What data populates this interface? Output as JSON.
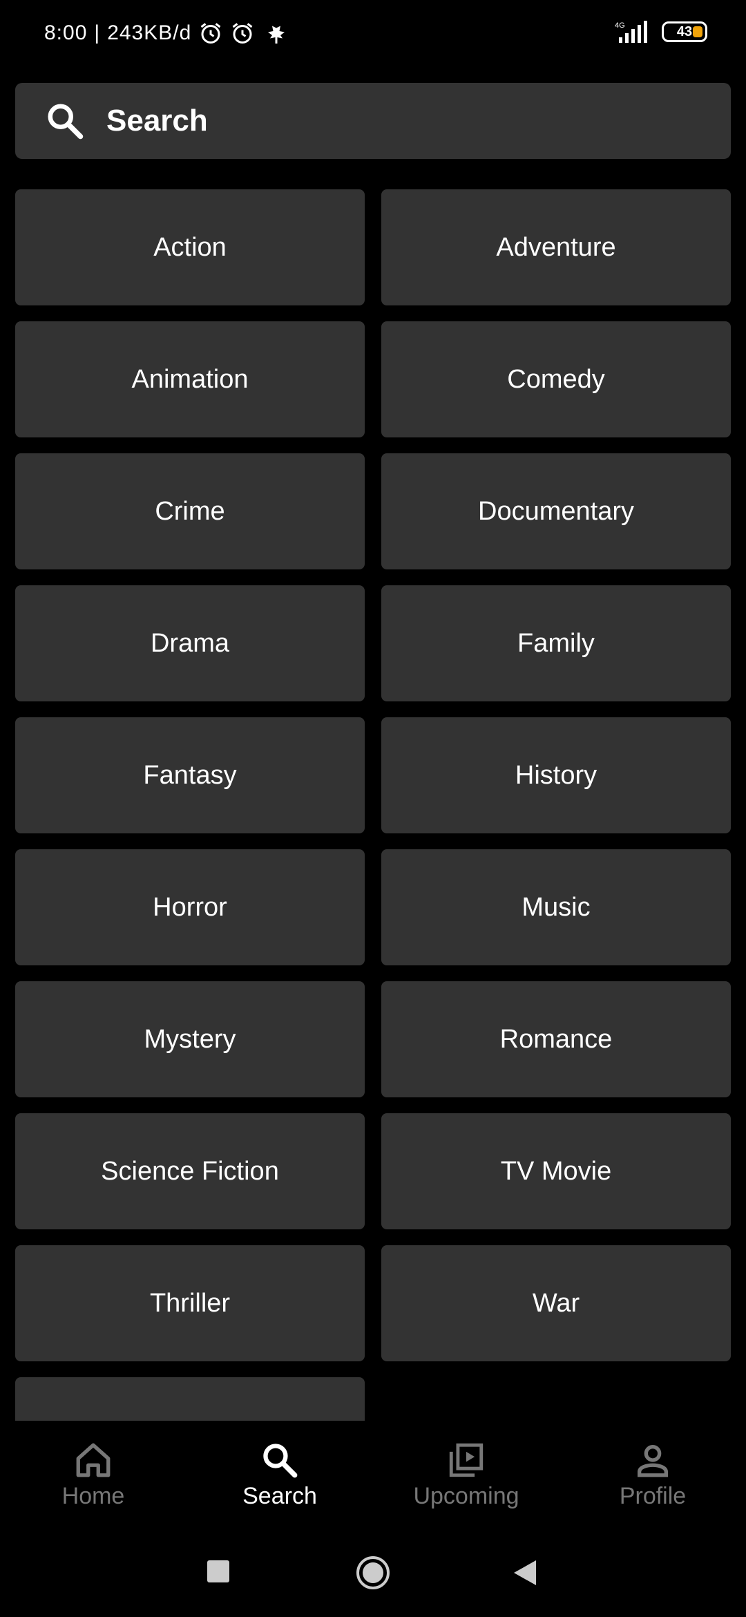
{
  "status_bar": {
    "time": "8:00",
    "net_speed": "243KB/d",
    "network": "4G",
    "battery": "43"
  },
  "search": {
    "placeholder": "Search"
  },
  "genres": [
    "Action",
    "Adventure",
    "Animation",
    "Comedy",
    "Crime",
    "Documentary",
    "Drama",
    "Family",
    "Fantasy",
    "History",
    "Horror",
    "Music",
    "Mystery",
    "Romance",
    "Science Fiction",
    "TV Movie",
    "Thriller",
    "War",
    ""
  ],
  "bottom_nav": {
    "items": [
      {
        "label": "Home",
        "icon": "home-icon"
      },
      {
        "label": "Search",
        "icon": "search-icon",
        "active": true
      },
      {
        "label": "Upcoming",
        "icon": "video-library-icon"
      },
      {
        "label": "Profile",
        "icon": "person-icon"
      }
    ]
  },
  "colors": {
    "background": "#000000",
    "tile": "#333333",
    "active": "#ffffff",
    "inactive": "#777777",
    "battery": "#f0a30a"
  }
}
